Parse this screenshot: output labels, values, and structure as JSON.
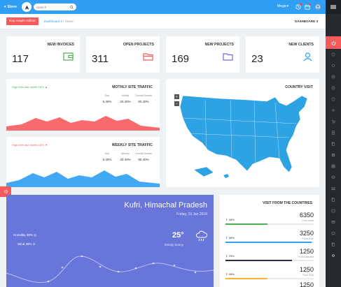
{
  "topbar": {
    "user_label": "Steve",
    "search_placeholder": "Search",
    "mega_label": "Mega"
  },
  "breadcrumb": {
    "buy_button": "Buy Ample Admin",
    "link": "Dashboard 3",
    "separator": "/",
    "current": "Home",
    "page_title": "DASHBOARD 3"
  },
  "stats": [
    {
      "label": "NEW INVOICES",
      "value": "117",
      "color": "#4caf50",
      "icon": "wallet-icon"
    },
    {
      "label": "OPEN PROJECTS",
      "value": "311",
      "color": "#f75a5b",
      "icon": "folder-icon"
    },
    {
      "label": "NEW PROJECTS",
      "value": "169",
      "color": "#7460ee",
      "icon": "folder-outline-icon"
    },
    {
      "label": "NEW CLIENTS",
      "value": "23",
      "color": "#2f9ef3",
      "icon": "users-icon"
    }
  ],
  "monthly": {
    "hint": "High then last month 18%",
    "hint_arrow": "▲",
    "title": "MOTHLY SITE TRAFFIC",
    "col_heads": [
      "Day",
      "Mothly",
      "Overall Growth"
    ],
    "col_values": [
      "5.40%",
      "20.40%",
      "80.40%"
    ],
    "color": "#f75a5b"
  },
  "weekly": {
    "hint": "High then last month 18%",
    "hint_arrow": "▼",
    "title": "WEEKLY SITE TRAFFIC",
    "col_heads": [
      "Day",
      "Weekly",
      "Overall Growth"
    ],
    "col_values": [
      "5.40%",
      "20.40%",
      "80.40%"
    ],
    "color": "#2f9ef3"
  },
  "country": {
    "title": "COUNTRY VISIT",
    "zoom_in": "+",
    "zoom_out": "−",
    "map_color": "#2ea3e3"
  },
  "weather": {
    "location": "Kufri, Himachal Pradesh",
    "date": "Friday, 19 Jan 2018",
    "temperature": "25°",
    "condition": "Mostly Sunny",
    "humidity": "Humidity 38%",
    "wind": "Wind 38%"
  },
  "visits": {
    "title": "VISIT FROM THE COUNTRIES",
    "rows": [
      {
        "value": "6350",
        "from": "From India",
        "pct": "48%",
        "dir": "up",
        "fill": 0.48,
        "color": "#4caf50"
      },
      {
        "value": "3250",
        "from": "From UAE",
        "pct": "98%",
        "dir": "up",
        "fill": 0.98,
        "color": "#2f9ef3"
      },
      {
        "value": "1250",
        "from": "From Australia",
        "pct": "75%",
        "dir": "down",
        "fill": 0.75,
        "color": "#2b2b3d"
      },
      {
        "value": "1250",
        "from": "From USA",
        "pct": "48%",
        "dir": "up",
        "fill": 0.48,
        "color": "#ffb22b"
      },
      {
        "value": "1250",
        "from": "",
        "pct": "",
        "dir": "up",
        "fill": 0.3,
        "color": "#f75a5b"
      }
    ]
  }
}
